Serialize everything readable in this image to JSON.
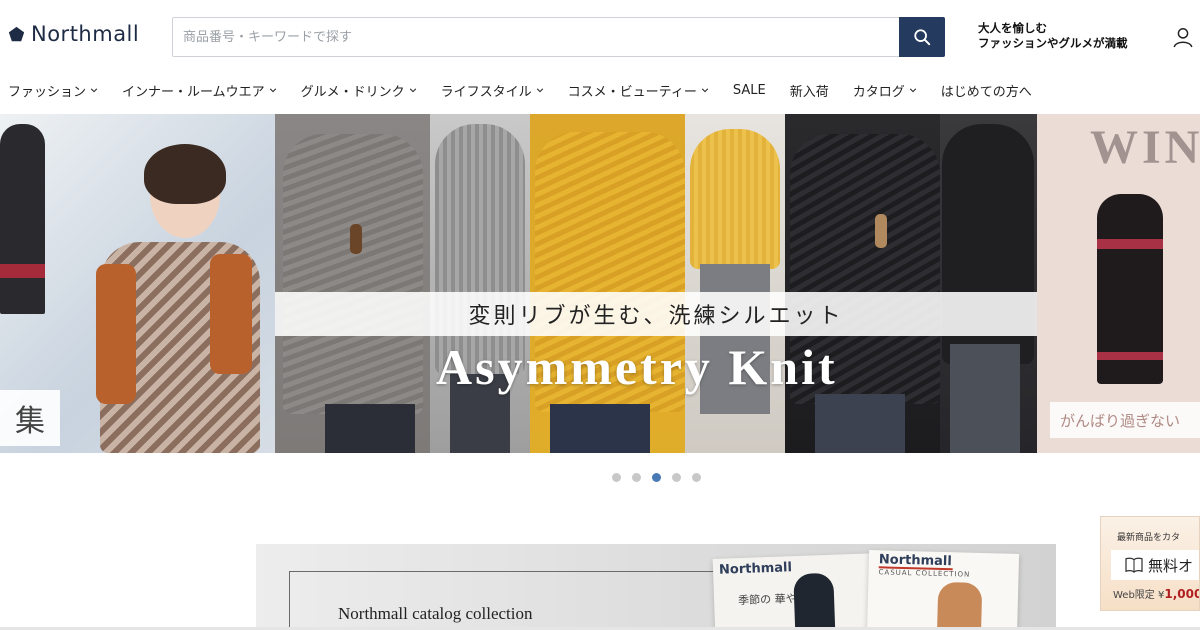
{
  "header": {
    "logo_text": "Northmall",
    "search_placeholder": "商品番号・キーワードで探す",
    "search_value": "",
    "tagline_line1": "大人を愉しむ",
    "tagline_line2": "ファッションやグルメが満載"
  },
  "nav": {
    "items": [
      {
        "label": "ファッション",
        "has_dropdown": true
      },
      {
        "label": "インナー・ルームウエア",
        "has_dropdown": true
      },
      {
        "label": "グルメ・ドリンク",
        "has_dropdown": true
      },
      {
        "label": "ライフスタイル",
        "has_dropdown": true
      },
      {
        "label": "コスメ・ビューティー",
        "has_dropdown": true
      },
      {
        "label": "SALE",
        "has_dropdown": false
      },
      {
        "label": "新入荷",
        "has_dropdown": false
      },
      {
        "label": "カタログ",
        "has_dropdown": true
      },
      {
        "label": "はじめての方へ",
        "has_dropdown": false
      }
    ]
  },
  "hero": {
    "subtitle": "変則リブが生む、洗練シルエット",
    "title": "Asymmetry Knit",
    "left_tag": "集",
    "right_title": "WIN",
    "right_caption": "がんばり過ぎない"
  },
  "carousel": {
    "total": 5,
    "active_index": 2
  },
  "catalog": {
    "title": "Northmall catalog collection",
    "brand1": "Northmall",
    "brand2": "Northmall",
    "brand2_sub": "CASUAL COLLECTION",
    "book_text": "季節の 華や"
  },
  "float_banner": {
    "line1": "最新商品をカタ",
    "free_label": "無料オ",
    "web_limited": "Web限定 ¥",
    "price": "1,000"
  },
  "colors": {
    "brand_navy": "#243a5e",
    "dot_active": "#4a7ab5",
    "dot_inactive": "#c8c8c8"
  }
}
